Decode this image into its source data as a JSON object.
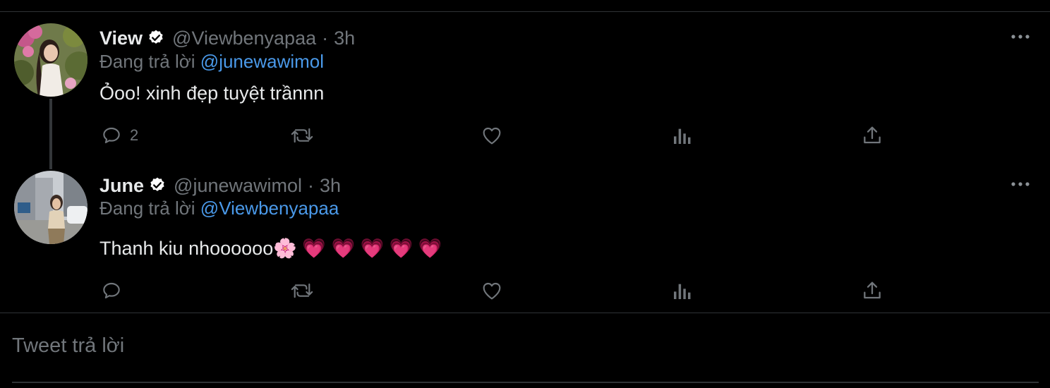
{
  "tweets": [
    {
      "name": "View",
      "handle": "@Viewbenyapaa",
      "separator": "·",
      "time": "3h",
      "replying_prefix": "Đang trả lời",
      "replying_to": "@junewawimol",
      "text": "Ỏoo! xinh đẹp tuyệt trầnnn",
      "reply_count": "2",
      "avatar_icon": "woman-with-flowers-avatar"
    },
    {
      "name": "June",
      "handle": "@junewawimol",
      "separator": "·",
      "time": "3h",
      "replying_prefix": "Đang trả lời",
      "replying_to": "@Viewbenyapaa",
      "text": "Thanh kiu nhoooooo🌸 💗 💗 💗 💗 💗",
      "reply_count": "",
      "avatar_icon": "woman-on-street-avatar"
    }
  ],
  "compose": {
    "placeholder": "Tweet trả lời"
  },
  "colors": {
    "background": "#000000",
    "text": "#e7e9ea",
    "muted": "#71767b",
    "link": "#4a99e9",
    "divider": "#2f3336"
  }
}
